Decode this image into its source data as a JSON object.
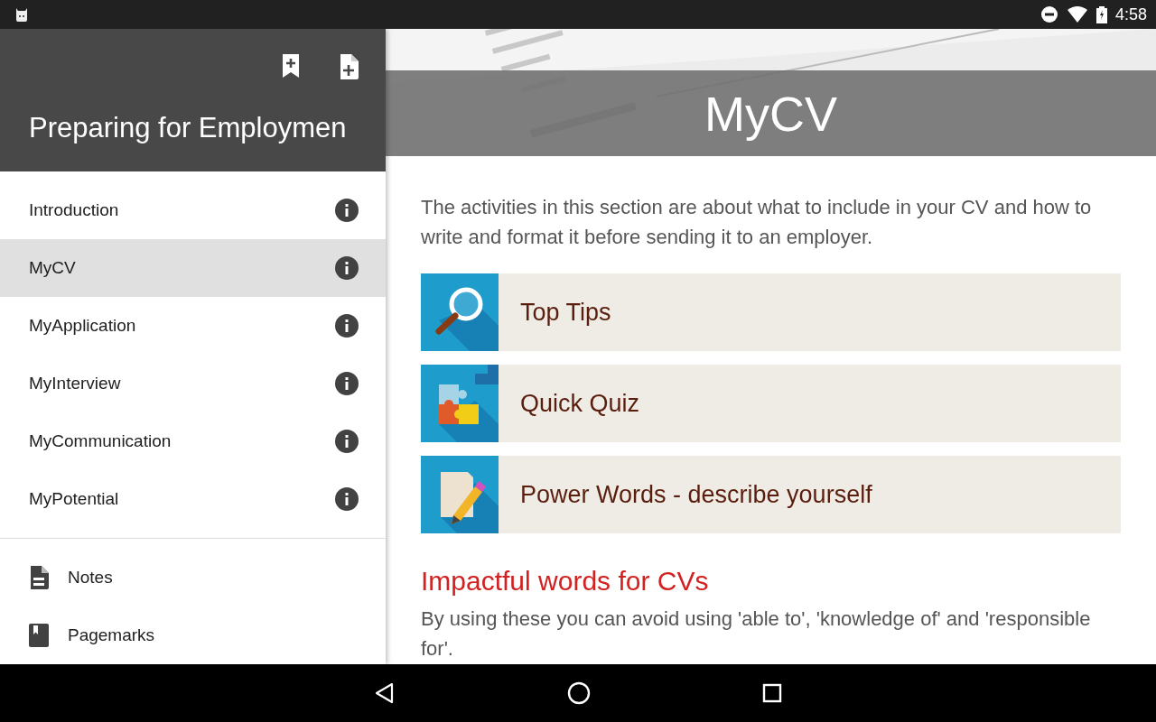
{
  "status_bar": {
    "time": "4:58"
  },
  "drawer": {
    "title": "Preparing for Employmen",
    "nav_items": [
      {
        "label": "Introduction",
        "selected": false
      },
      {
        "label": "MyCV",
        "selected": true
      },
      {
        "label": "MyApplication",
        "selected": false
      },
      {
        "label": "MyInterview",
        "selected": false
      },
      {
        "label": "MyCommunication",
        "selected": false
      },
      {
        "label": "MyPotential",
        "selected": false
      }
    ],
    "footer_items": [
      {
        "label": "Notes",
        "kind": "notes"
      },
      {
        "label": "Pagemarks",
        "kind": "pagemarks"
      }
    ]
  },
  "content": {
    "title": "MyCV",
    "intro": "The activities in this section are about what to include in your CV and how to write and format it before sending it to an employer.",
    "activities": [
      {
        "label": "Top Tips",
        "kind": "magnifier"
      },
      {
        "label": "Quick Quiz",
        "kind": "puzzle"
      },
      {
        "label": "Power Words - describe yourself",
        "kind": "pencil"
      }
    ],
    "heading": "Impactful words for CVs",
    "body": "By using these you can avoid using 'able to', 'knowledge of' and 'responsible for'."
  }
}
